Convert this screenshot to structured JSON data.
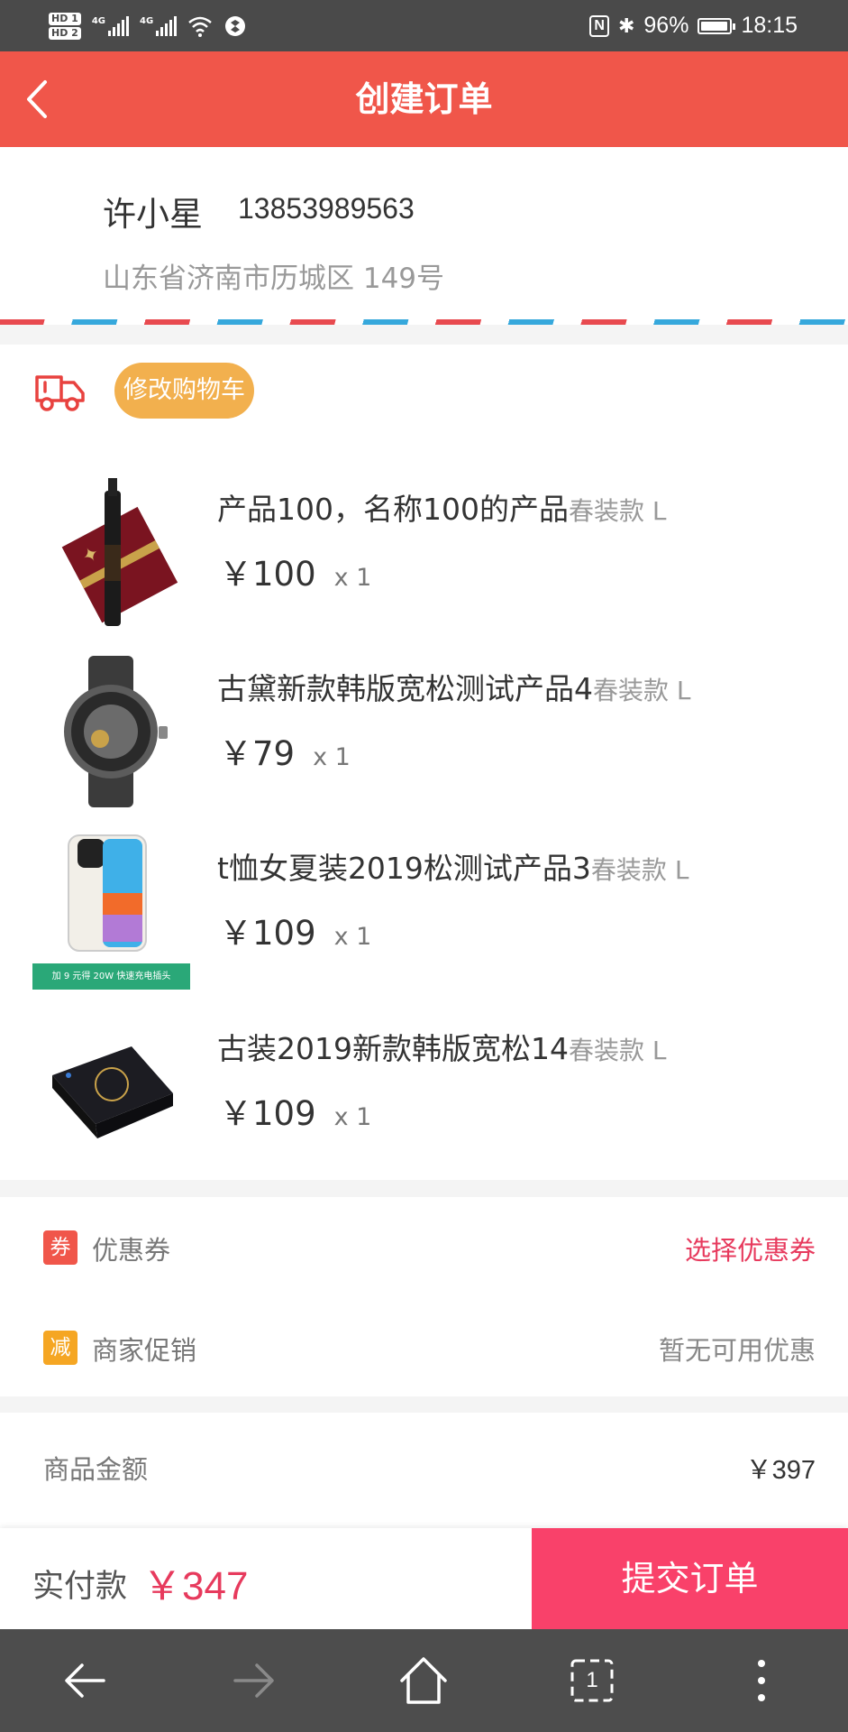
{
  "status_bar": {
    "hd1": "HD 1",
    "hd2": "HD 2",
    "net1": "4G",
    "net2": "4G",
    "nfc": "N",
    "bluetooth": "✱",
    "battery": "96%",
    "battery_level": 0.96,
    "time": "18:15"
  },
  "header": {
    "title": "创建订单",
    "back_icon": "chevron-left-icon"
  },
  "address": {
    "name": "许小星",
    "phone": "13853989563",
    "detail": "山东省济南市历城区 149号"
  },
  "cart": {
    "truck_icon": "truck-icon",
    "edit_label": "修改购物车",
    "items": [
      {
        "title": "产品100，名称100的产品",
        "spec": "春装款 L",
        "price": "￥100",
        "qty": "x 1",
        "thumb": "wine-bottle"
      },
      {
        "title": "古黛新款韩版宽松测试产品4",
        "spec": "春装款 L",
        "price": "￥79",
        "qty": "x 1",
        "thumb": "wristwatch"
      },
      {
        "title": "t恤女夏装2019松测试产品3",
        "spec": "春装款 L",
        "price": "￥109",
        "qty": "x 1",
        "thumb": "smartphone",
        "banner": "加 9 元得 20W 快速充电插头"
      },
      {
        "title": "古装2019新款韩版宽松14",
        "spec": "春装款 L",
        "price": "￥109",
        "qty": "x 1",
        "thumb": "black-gift-box"
      }
    ]
  },
  "discounts": {
    "coupon": {
      "badge": "券",
      "label": "优惠券",
      "value": "选择优惠券",
      "color": "#f0564a",
      "value_color": "#e73a5d"
    },
    "promo": {
      "badge": "减",
      "label": "商家促销",
      "value": "暂无可用优惠",
      "color": "#f5a623",
      "value_color": "#888888"
    }
  },
  "amount": {
    "label": "商品金额",
    "value": "￥397"
  },
  "footer": {
    "pay_label": "实付款",
    "pay_value": "￥347",
    "submit_label": "提交订单"
  },
  "browser_nav": {
    "tab_count": "1"
  },
  "colors": {
    "header": "#f0564a",
    "accent": "#f9416a",
    "edit_button": "#f2b04e"
  }
}
